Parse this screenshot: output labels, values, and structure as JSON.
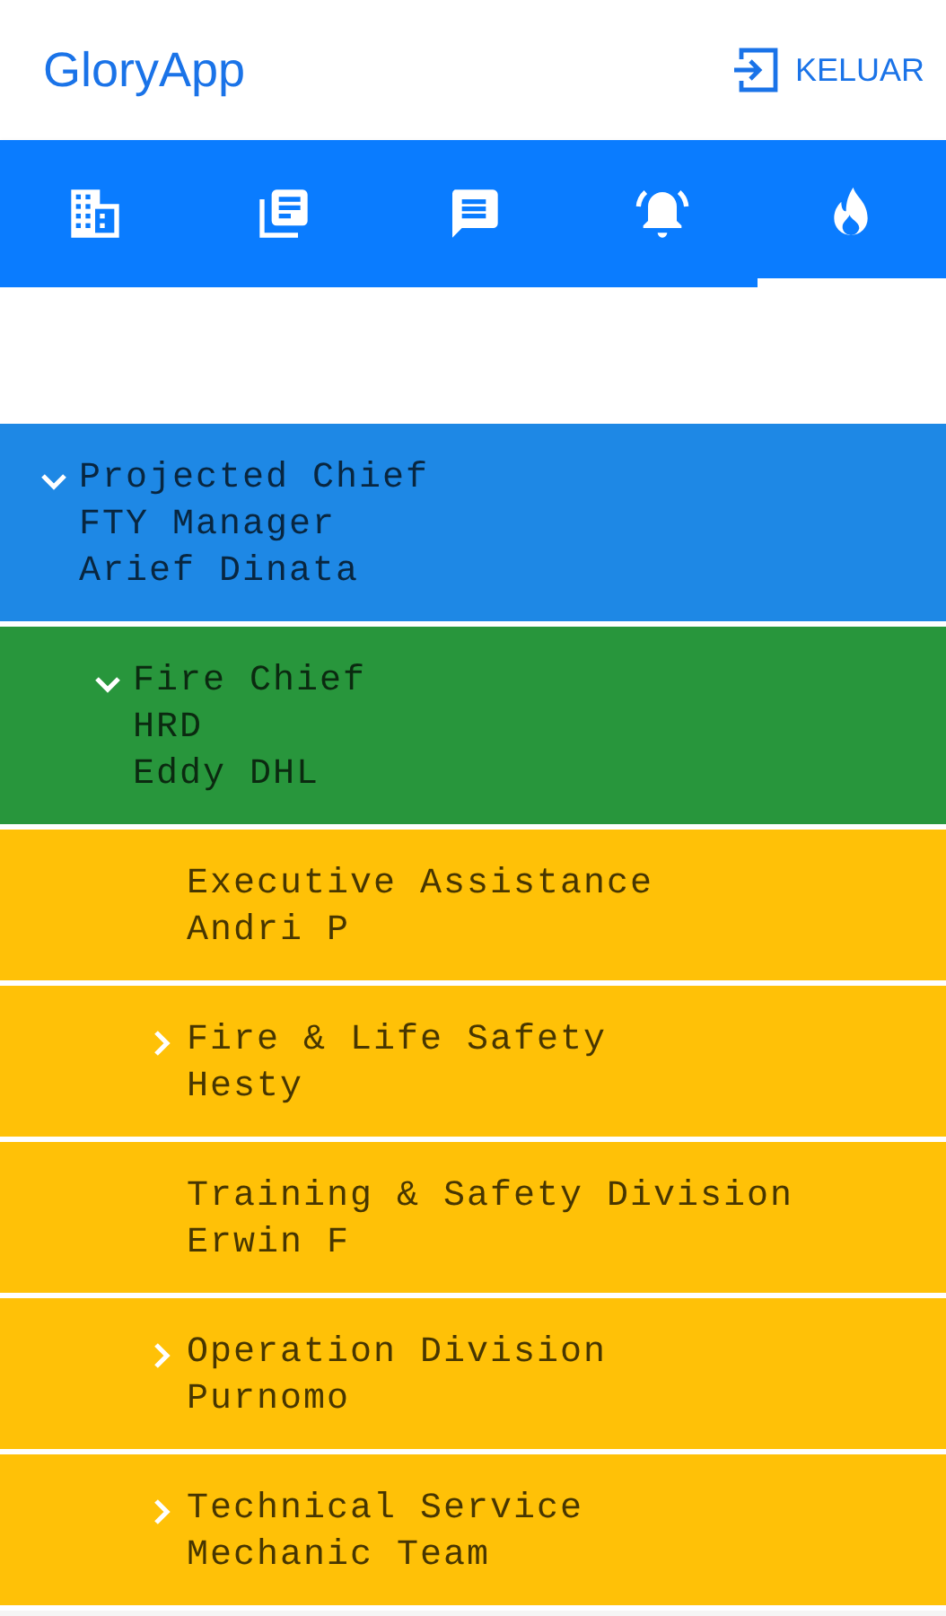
{
  "app_bar": {
    "title": "GloryApp",
    "logout_label": "KELUAR"
  },
  "tabs": [
    {
      "kind": "building",
      "selected": false
    },
    {
      "kind": "documents",
      "selected": false
    },
    {
      "kind": "chat",
      "selected": false
    },
    {
      "kind": "bell",
      "selected": false
    },
    {
      "kind": "flame",
      "selected": true
    }
  ],
  "tree": [
    {
      "lines": [
        "Projected Chief",
        "FTY Manager",
        "Arief Dinata"
      ],
      "color": "#1e88e5",
      "expanded": true,
      "children": [
        {
          "lines": [
            "Fire Chief",
            "HRD",
            "Eddy DHL"
          ],
          "color": "#28963c",
          "expanded": true,
          "children": [
            {
              "lines": [
                "Executive Assistance",
                "Andri P"
              ],
              "color": "#ffc107"
            },
            {
              "lines": [
                "Fire & Life Safety",
                "Hesty"
              ],
              "color": "#ffc107",
              "expanded": false
            },
            {
              "lines": [
                "Training & Safety Division",
                "Erwin F"
              ],
              "color": "#ffc107"
            },
            {
              "lines": [
                "Operation Division",
                "Purnomo"
              ],
              "color": "#ffc107",
              "expanded": false
            },
            {
              "lines": [
                "Technical Service",
                "Mechanic Team"
              ],
              "color": "#ffc107",
              "expanded": false
            }
          ]
        }
      ]
    }
  ]
}
